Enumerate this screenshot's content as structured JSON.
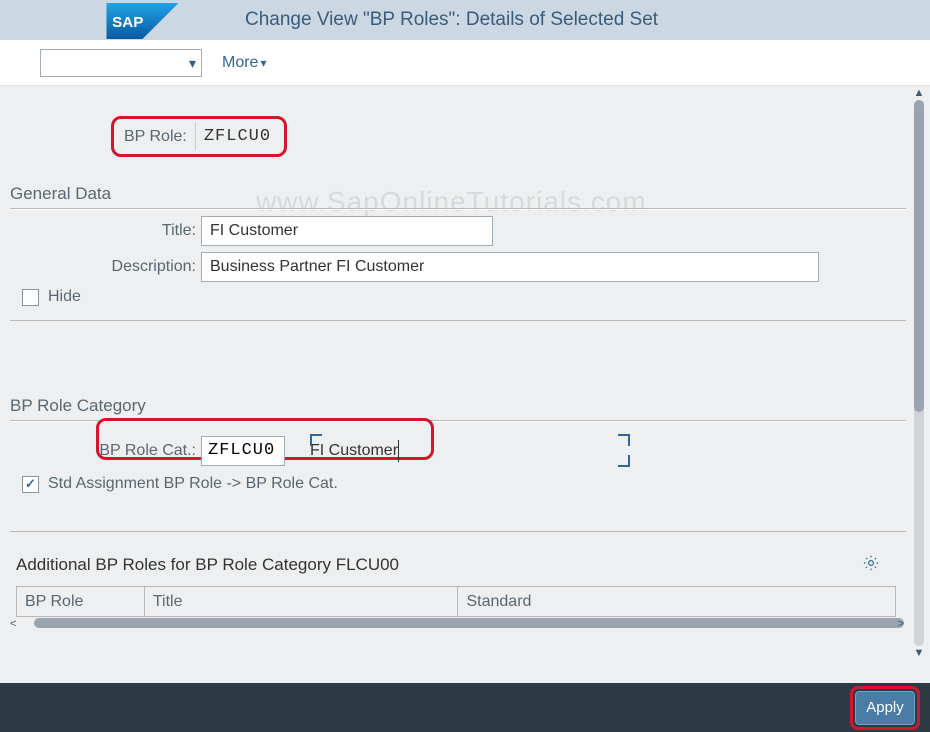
{
  "header": {
    "logo_text": "SAP",
    "title": "Change View \"BP Roles\": Details of Selected Set"
  },
  "toolbar": {
    "dropdown_value": "",
    "more_label": "More"
  },
  "watermark": "www.SapOnlineTutorials.com",
  "bp_role": {
    "label": "BP Role:",
    "value": "ZFLCU0"
  },
  "general_data": {
    "heading": "General Data",
    "title_label": "Title:",
    "title_value": "FI Customer",
    "description_label": "Description:",
    "description_value": "Business Partner FI Customer",
    "hide_label": "Hide",
    "hide_checked": false
  },
  "bp_role_category": {
    "heading": "BP Role Category",
    "cat_label": "BP Role Cat.:",
    "cat_value": "ZFLCU0",
    "cat_desc": "FI Customer",
    "std_label": "Std Assignment BP Role -> BP Role Cat.",
    "std_checked": true
  },
  "additional": {
    "heading": "Additional BP Roles for BP Role Category FLCU00",
    "columns": [
      "BP Role",
      "Title",
      "Standard"
    ]
  },
  "footer": {
    "apply_label": "Apply"
  }
}
